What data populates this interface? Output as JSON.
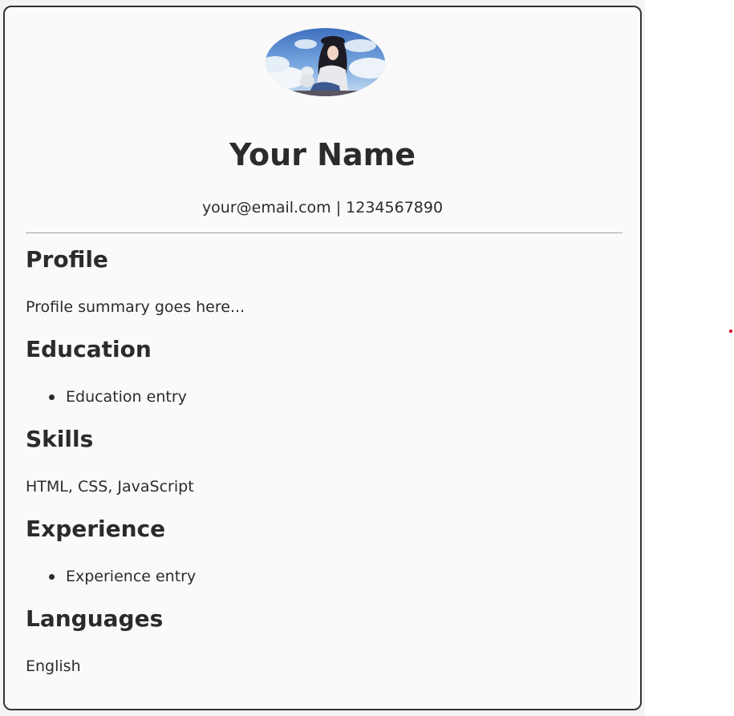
{
  "header": {
    "name": "Your Name",
    "contact": "your@email.com | 1234567890",
    "avatar_icon": "profile-photo"
  },
  "sections": {
    "profile": {
      "title": "Profile",
      "text": "Profile summary goes here..."
    },
    "education": {
      "title": "Education",
      "items": [
        "Education entry"
      ]
    },
    "skills": {
      "title": "Skills",
      "text": "HTML, CSS, JavaScript"
    },
    "experience": {
      "title": "Experience",
      "items": [
        "Experience entry"
      ]
    },
    "languages": {
      "title": "Languages",
      "text": "English"
    }
  },
  "colors": {
    "card_border": "#333333",
    "card_background": "#fafafa",
    "text": "#2b2b2b",
    "divider": "#a0a0a0",
    "marker_dot": "#d0021b"
  }
}
